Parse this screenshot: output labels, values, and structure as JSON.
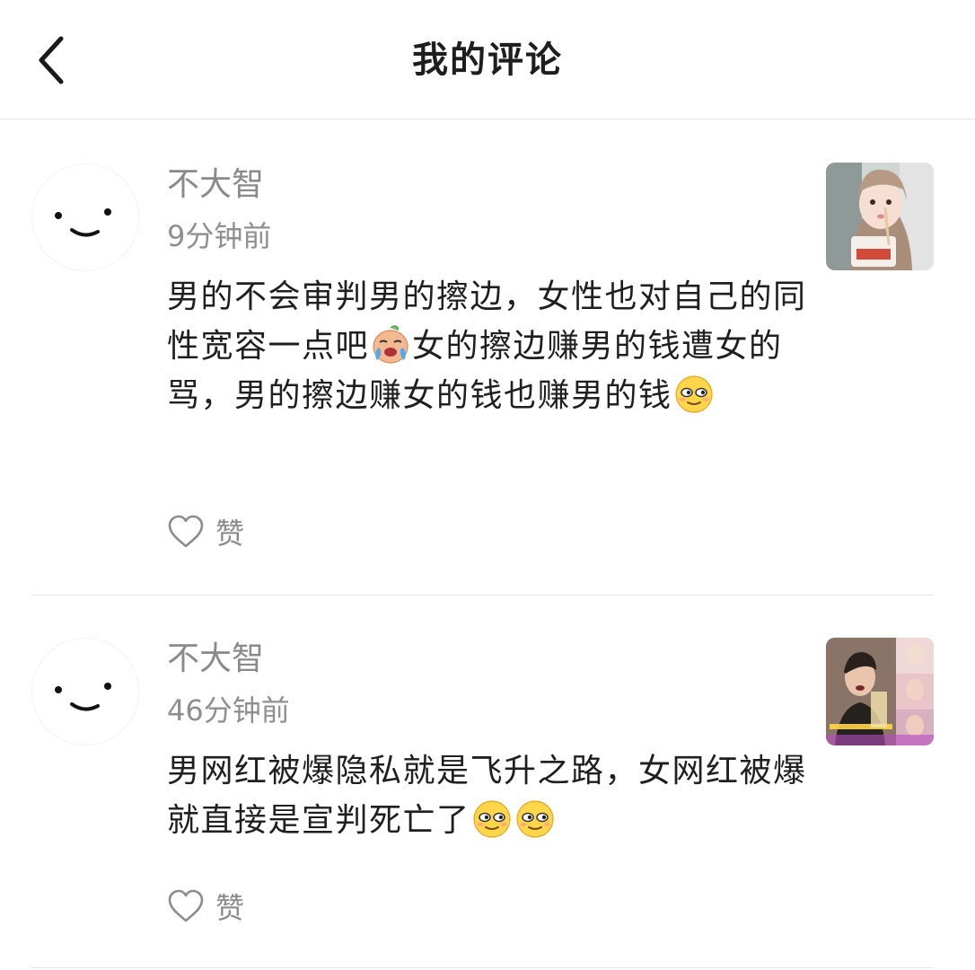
{
  "header": {
    "title": "我的评论",
    "back_icon": "chevron-left-icon"
  },
  "comments": [
    {
      "username": "不大智",
      "time": "9分钟前",
      "text_parts": [
        "男的不会审判男的擦边，女性也对自己的同性宽容一点吧",
        "女的擦边赚男的钱遭女的骂，男的擦边赚女的钱也赚男的钱"
      ],
      "emojis": [
        "crying-face-emoji",
        "smug-face-emoji"
      ],
      "like_label": "赞",
      "like_icon": "heart-outline-icon"
    },
    {
      "username": "不大智",
      "time": "46分钟前",
      "text_parts": [
        "男网红被爆隐私就是飞升之路，女网红被爆就直接是宣判死亡了"
      ],
      "emojis": [
        "smug-face-emoji",
        "smug-face-emoji"
      ],
      "like_label": "赞",
      "like_icon": "heart-outline-icon"
    }
  ],
  "colors": {
    "username": "#8a8a8a",
    "divider": "#e8e8e8",
    "text": "#1f1f1f"
  }
}
